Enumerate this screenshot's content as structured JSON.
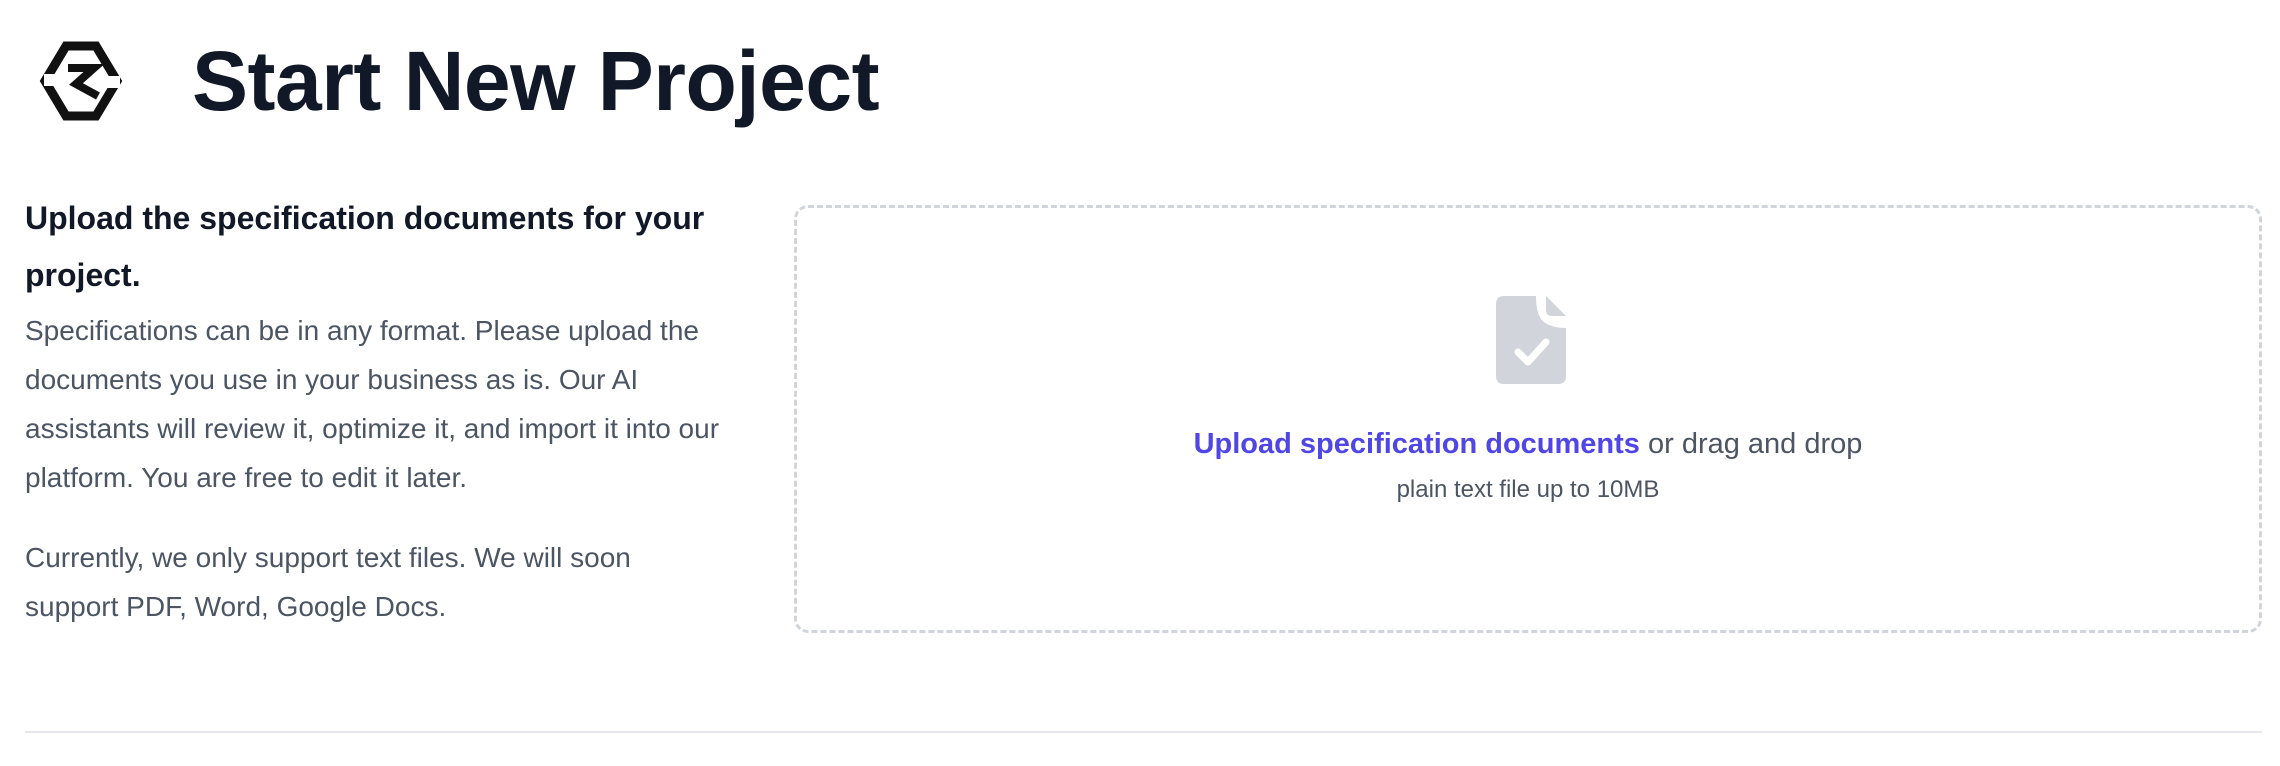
{
  "header": {
    "logo_icon": "hexagon-squiggle-logo-icon",
    "title": "Start New Project"
  },
  "intro": {
    "heading": "Upload the specification documents for your project.",
    "paragraph1": "Specifications can be in any format. Please upload the documents you use in your business as is. Our AI assistants will review it, optimize it, and import it into our platform. You are free to edit it later.",
    "paragraph2": "Currently, we only support text files. We will soon support PDF, Word, Google Docs."
  },
  "dropzone": {
    "icon": "document-check-icon",
    "link_label": "Upload specification documents",
    "drag_text": " or drag and drop",
    "hint": "plain text file up to 10MB"
  },
  "colors": {
    "title": "#111827",
    "body_text": "#4b5563",
    "link": "#4f46e5",
    "dropzone_border": "#d1d5db",
    "icon": "#d1d5db"
  }
}
